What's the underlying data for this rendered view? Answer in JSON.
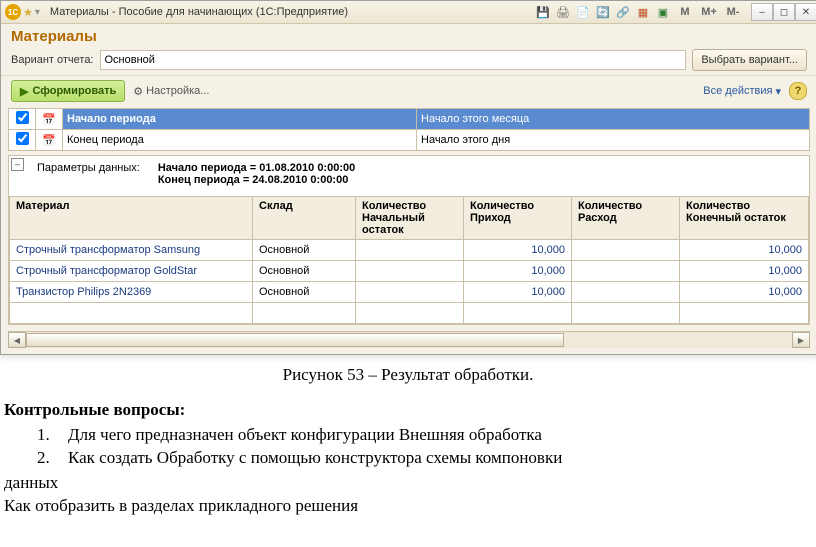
{
  "titlebar": {
    "logo_text": "1C",
    "title": "Материалы - Пособие для начинающих  (1С:Предприятие)",
    "m_labels": [
      "M",
      "M+",
      "M-"
    ]
  },
  "header": {
    "title": "Материалы"
  },
  "variant": {
    "label": "Вариант отчета:",
    "value": "Основной",
    "choose_btn": "Выбрать вариант..."
  },
  "toolbar": {
    "run": "Сформировать",
    "settings": "Настройка...",
    "all_actions": "Все действия"
  },
  "periods": [
    {
      "checked": true,
      "name": "Начало периода",
      "value": "Начало этого месяца",
      "selected": true
    },
    {
      "checked": true,
      "name": "Конец периода",
      "value": "Начало этого дня",
      "selected": false
    }
  ],
  "params": {
    "label": "Параметры данных:",
    "lines": [
      "Начало периода = 01.08.2010 0:00:00",
      "Конец периода = 24.08.2010 0:00:00"
    ]
  },
  "columns": [
    "Материал",
    "Склад",
    "Количество Начальный остаток",
    "Количество Приход",
    "Количество Расход",
    "Количество Конечный остаток"
  ],
  "rows": [
    {
      "mat": "Строчный трансформатор Samsung",
      "sklad": "Основной",
      "nach": "",
      "prih": "10,000",
      "rash": "",
      "kon": "10,000"
    },
    {
      "mat": "Строчный трансформатор GoldStar",
      "sklad": "Основной",
      "nach": "",
      "prih": "10,000",
      "rash": "",
      "kon": "10,000"
    },
    {
      "mat": "Транзистор Philips 2N2369",
      "sklad": "Основной",
      "nach": "",
      "prih": "10,000",
      "rash": "",
      "kon": "10,000"
    }
  ],
  "caption": "Рисунок 53 – Результат обработки.",
  "questions": {
    "heading": "Контрольные вопросы:",
    "items": [
      "Для чего предназначен объект конфигурации Внешняя обработка",
      "Как создать Обработку с помощью конструктора схемы компоновки"
    ],
    "trail1": "данных",
    "trail2": "Как отобразить в разделах прикладного решения"
  }
}
